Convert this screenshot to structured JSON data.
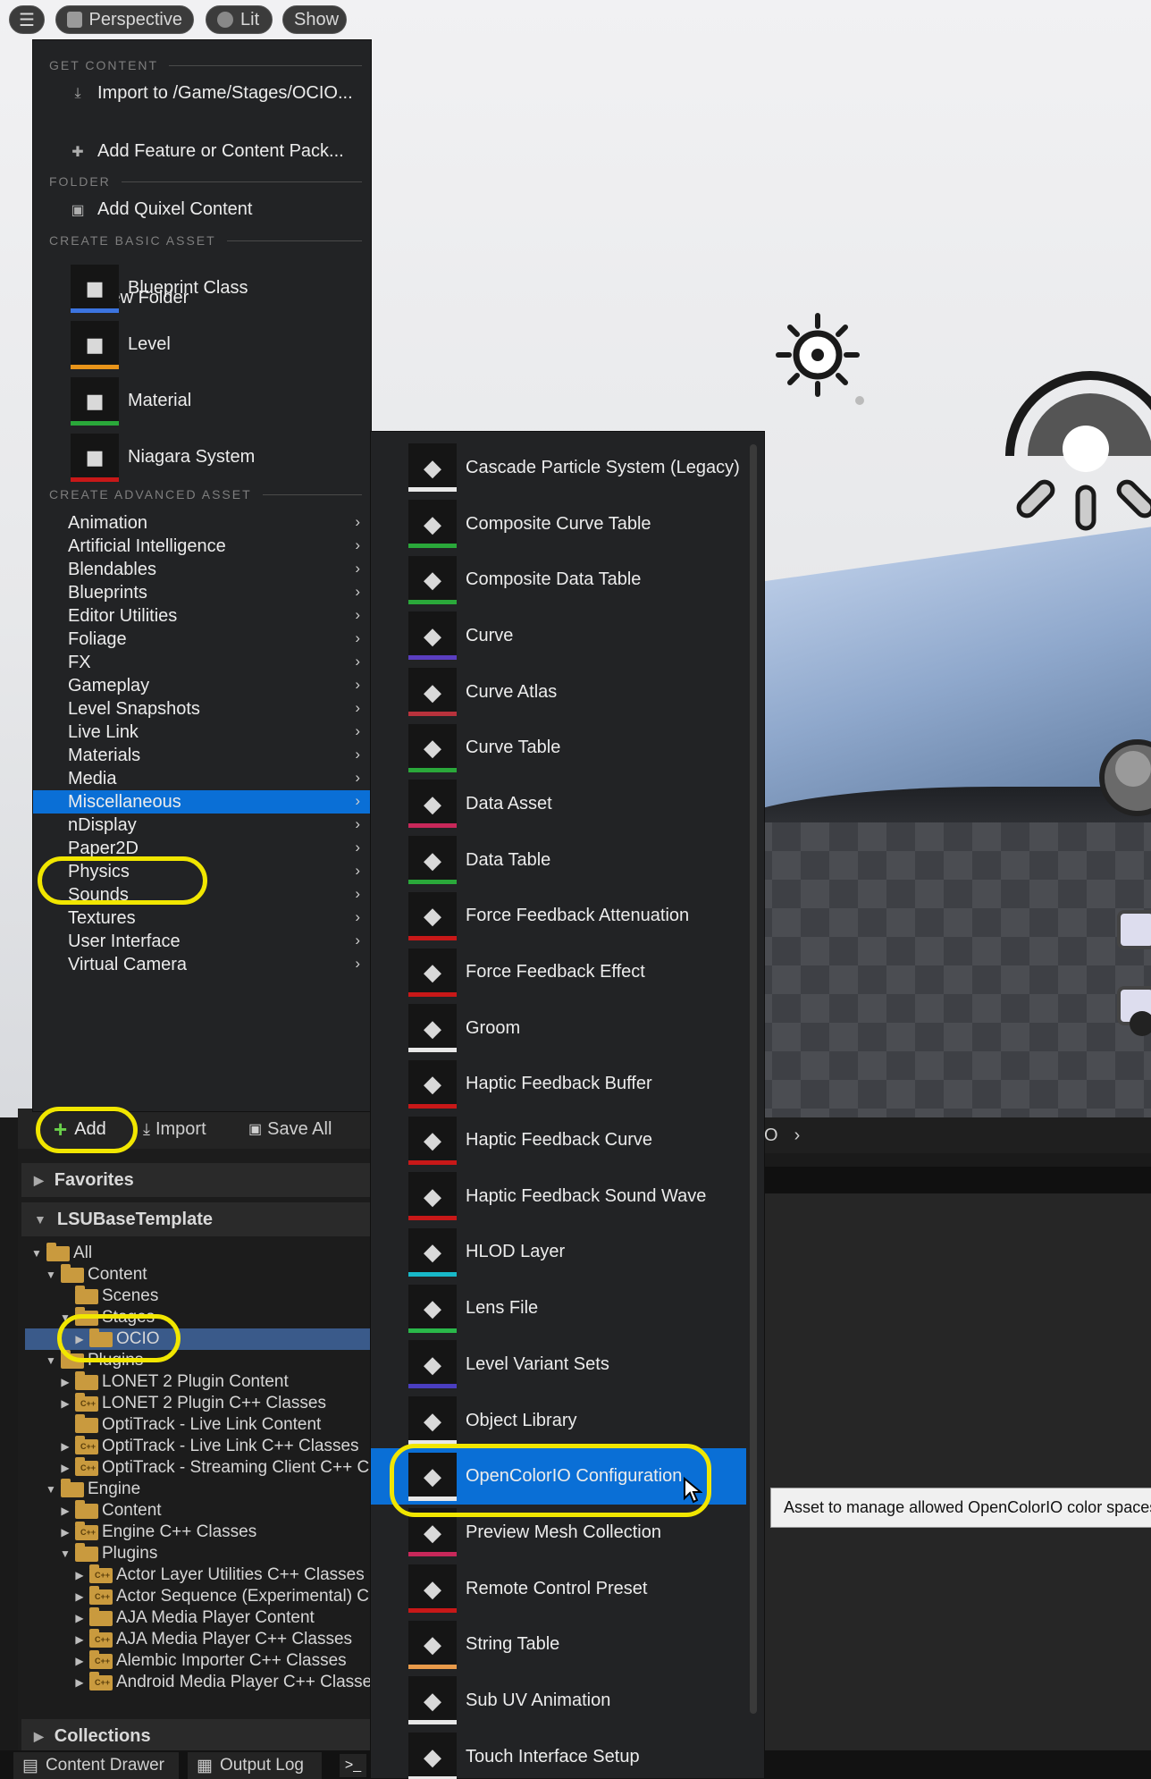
{
  "viewport": {
    "menu_button": "☰",
    "perspective_label": "Perspective",
    "lit_label": "Lit",
    "show_label": "Show"
  },
  "add_menu": {
    "get_content_header": "GET CONTENT",
    "import_label": "Import to /Game/Stages/OCIO...",
    "feature_pack_label": "Add Feature or Content Pack...",
    "quixel_label": "Add Quixel Content",
    "folder_header": "FOLDER",
    "new_folder_label": "New Folder",
    "basic_asset_header": "CREATE BASIC ASSET",
    "basic_assets": [
      {
        "label": "Blueprint Class",
        "icon": "blueprint-icon",
        "color": "#3c74e0"
      },
      {
        "label": "Level",
        "icon": "level-icon",
        "color": "#e8941a"
      },
      {
        "label": "Material",
        "icon": "material-icon",
        "color": "#2aa83a"
      },
      {
        "label": "Niagara System",
        "icon": "niagara-icon",
        "color": "#c81818"
      }
    ],
    "advanced_asset_header": "CREATE ADVANCED ASSET",
    "categories": [
      "Animation",
      "Artificial Intelligence",
      "Blendables",
      "Blueprints",
      "Editor Utilities",
      "Foliage",
      "FX",
      "Gameplay",
      "Level Snapshots",
      "Live Link",
      "Materials",
      "Media",
      "Miscellaneous",
      "nDisplay",
      "Paper2D",
      "Physics",
      "Sounds",
      "Textures",
      "User Interface",
      "Virtual Camera"
    ],
    "selected_category": "Miscellaneous"
  },
  "submenu": {
    "items": [
      {
        "label": "Cascade Particle System (Legacy)",
        "icon": "sparkle-icon",
        "color": "#e8e8e8"
      },
      {
        "label": "Composite Curve Table",
        "icon": "cube-icon",
        "color": "#2aa83a"
      },
      {
        "label": "Composite Data Table",
        "icon": "bar-chart-icon",
        "color": "#2aa83a"
      },
      {
        "label": "Curve",
        "icon": "curve-icon",
        "color": "#5a3ec0"
      },
      {
        "label": "Curve Atlas",
        "icon": "checker-icon",
        "color": "#b8323c"
      },
      {
        "label": "Curve Table",
        "icon": "cube-icon",
        "color": "#2aa83a"
      },
      {
        "label": "Data Asset",
        "icon": "pie-icon",
        "color": "#c8285a"
      },
      {
        "label": "Data Table",
        "icon": "bar-chart-icon",
        "color": "#2aa83a"
      },
      {
        "label": "Force Feedback Attenuation",
        "icon": "cube-icon",
        "color": "#c81818"
      },
      {
        "label": "Force Feedback Effect",
        "icon": "gamepad-icon",
        "color": "#c81818"
      },
      {
        "label": "Groom",
        "icon": "hair-icon",
        "color": "#e8e8e8"
      },
      {
        "label": "Haptic Feedback Buffer",
        "icon": "cube-icon",
        "color": "#c81818"
      },
      {
        "label": "Haptic Feedback Curve",
        "icon": "cube-icon",
        "color": "#c81818"
      },
      {
        "label": "Haptic Feedback Sound Wave",
        "icon": "cube-icon",
        "color": "#c81818"
      },
      {
        "label": "HLOD Layer",
        "icon": "cube-icon",
        "color": "#18b8c8"
      },
      {
        "label": "Lens File",
        "icon": "lens-icon",
        "color": "#2ab84a"
      },
      {
        "label": "Level Variant Sets",
        "icon": "cube-icon",
        "color": "#4a3ec0"
      },
      {
        "label": "Object Library",
        "icon": "stack-icon",
        "color": "#e8e8e8"
      },
      {
        "label": "OpenColorIO Configuration",
        "icon": "droplet-icon",
        "color": "#e8e8e8"
      },
      {
        "label": "Preview Mesh Collection",
        "icon": "pie-icon",
        "color": "#c8285a"
      },
      {
        "label": "Remote Control Preset",
        "icon": "monitor-icon",
        "color": "#c81818"
      },
      {
        "label": "String Table",
        "icon": "list-icon",
        "color": "#e89a4a"
      },
      {
        "label": "Sub UV Animation",
        "icon": "cube-icon",
        "color": "#e8e8e8"
      },
      {
        "label": "Touch Interface Setup",
        "icon": "phone-icon",
        "color": "#e8e8e8"
      }
    ],
    "selected_item": "OpenColorIO Configuration",
    "tooltip": "Asset to manage allowed OpenColorIO color spaces."
  },
  "content_browser": {
    "add_label": "Add",
    "import_label": "Import",
    "save_all_label": "Save All",
    "path_fragment": "O",
    "favorites_label": "Favorites",
    "project_label": "LSUBaseTemplate",
    "collections_label": "Collections",
    "tree": [
      {
        "label": "All",
        "indent": 0,
        "tri": "▼",
        "cpp": false
      },
      {
        "label": "Content",
        "indent": 1,
        "tri": "▼",
        "cpp": false
      },
      {
        "label": "Scenes",
        "indent": 2,
        "tri": "",
        "cpp": false
      },
      {
        "label": "Stages",
        "indent": 2,
        "tri": "▼",
        "cpp": false
      },
      {
        "label": "OCIO",
        "indent": 3,
        "tri": "▶",
        "cpp": false,
        "selected": true
      },
      {
        "label": "Plugins",
        "indent": 1,
        "tri": "▼",
        "cpp": false
      },
      {
        "label": "LONET 2 Plugin Content",
        "indent": 2,
        "tri": "▶",
        "cpp": false
      },
      {
        "label": "LONET 2 Plugin C++ Classes",
        "indent": 2,
        "tri": "▶",
        "cpp": true
      },
      {
        "label": "OptiTrack - Live Link Content",
        "indent": 2,
        "tri": "",
        "cpp": false
      },
      {
        "label": "OptiTrack - Live Link C++ Classes",
        "indent": 2,
        "tri": "▶",
        "cpp": true
      },
      {
        "label": "OptiTrack - Streaming Client C++ C",
        "indent": 2,
        "tri": "▶",
        "cpp": true
      },
      {
        "label": "Engine",
        "indent": 1,
        "tri": "▼",
        "cpp": false
      },
      {
        "label": "Content",
        "indent": 2,
        "tri": "▶",
        "cpp": false
      },
      {
        "label": "Engine C++ Classes",
        "indent": 2,
        "tri": "▶",
        "cpp": true
      },
      {
        "label": "Plugins",
        "indent": 2,
        "tri": "▼",
        "cpp": false
      },
      {
        "label": "Actor Layer Utilities C++ Classes",
        "indent": 3,
        "tri": "▶",
        "cpp": true
      },
      {
        "label": "Actor Sequence (Experimental) C",
        "indent": 3,
        "tri": "▶",
        "cpp": true
      },
      {
        "label": "AJA Media Player Content",
        "indent": 3,
        "tri": "▶",
        "cpp": false
      },
      {
        "label": "AJA Media Player C++ Classes",
        "indent": 3,
        "tri": "▶",
        "cpp": true
      },
      {
        "label": "Alembic Importer C++ Classes",
        "indent": 3,
        "tri": "▶",
        "cpp": true
      },
      {
        "label": "Android Media Player C++ Classe",
        "indent": 3,
        "tri": "▶",
        "cpp": true
      }
    ]
  },
  "bottom_tabs": [
    "Content Drawer",
    "Output Log"
  ]
}
